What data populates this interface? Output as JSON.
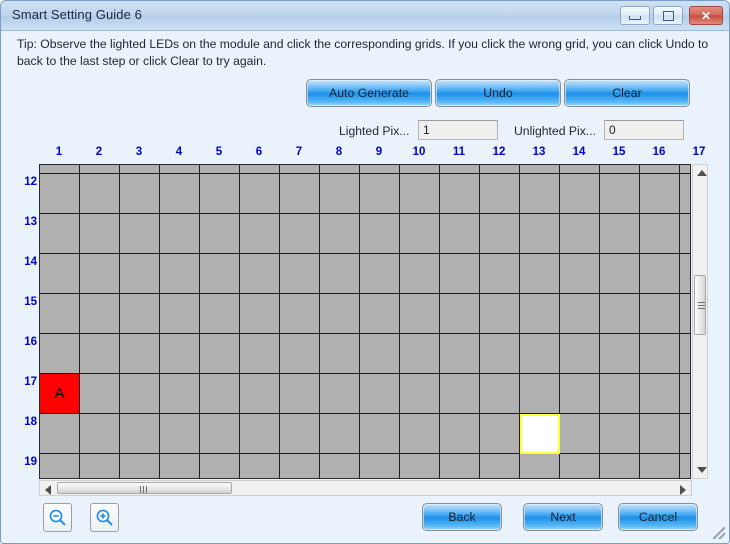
{
  "window": {
    "title": "Smart Setting Guide 6",
    "controls": {
      "minimize": "minimize-button",
      "maximize": "maximize-button",
      "close": "✕"
    }
  },
  "tip": {
    "text": "Tip: Observe the lighted LEDs on the module and click the corresponding grids. If you click the wrong grid, you can click Undo to back to the last step or click Clear to try again."
  },
  "toolbar": {
    "auto_generate_label": "Auto Generate",
    "undo_label": "Undo",
    "clear_label": "Clear"
  },
  "counters": {
    "lighted_label": "Lighted Pix...",
    "lighted_value": "1",
    "unlighted_label": "Unlighted Pix...",
    "unlighted_value": "0"
  },
  "grid": {
    "column_headers": [
      "1",
      "2",
      "3",
      "4",
      "5",
      "6",
      "7",
      "8",
      "9",
      "10",
      "11",
      "12",
      "13",
      "14",
      "15",
      "16",
      "17"
    ],
    "row_headers": [
      "12",
      "13",
      "14",
      "15",
      "16",
      "17",
      "18",
      "19"
    ],
    "marked_cell": {
      "col": 1,
      "row": 17,
      "label": "A",
      "color": "#fe0000"
    },
    "hover_cell": {
      "col": 13,
      "row": 18,
      "color": "#ffffff",
      "border_color": "#ffff33"
    }
  },
  "zoom_controls": {
    "zoom_out_label": "zoom-out",
    "zoom_in_label": "zoom-in"
  },
  "footer": {
    "back_label": "Back",
    "next_label": "Next",
    "cancel_label": "Cancel"
  },
  "colors": {
    "grid_cell": "#b0b0b0",
    "grid_line": "#1c1c1c",
    "header_text": "#0000c8",
    "accent_blue": "#1b8de8",
    "dialog_bg": "#eaf2fb"
  }
}
